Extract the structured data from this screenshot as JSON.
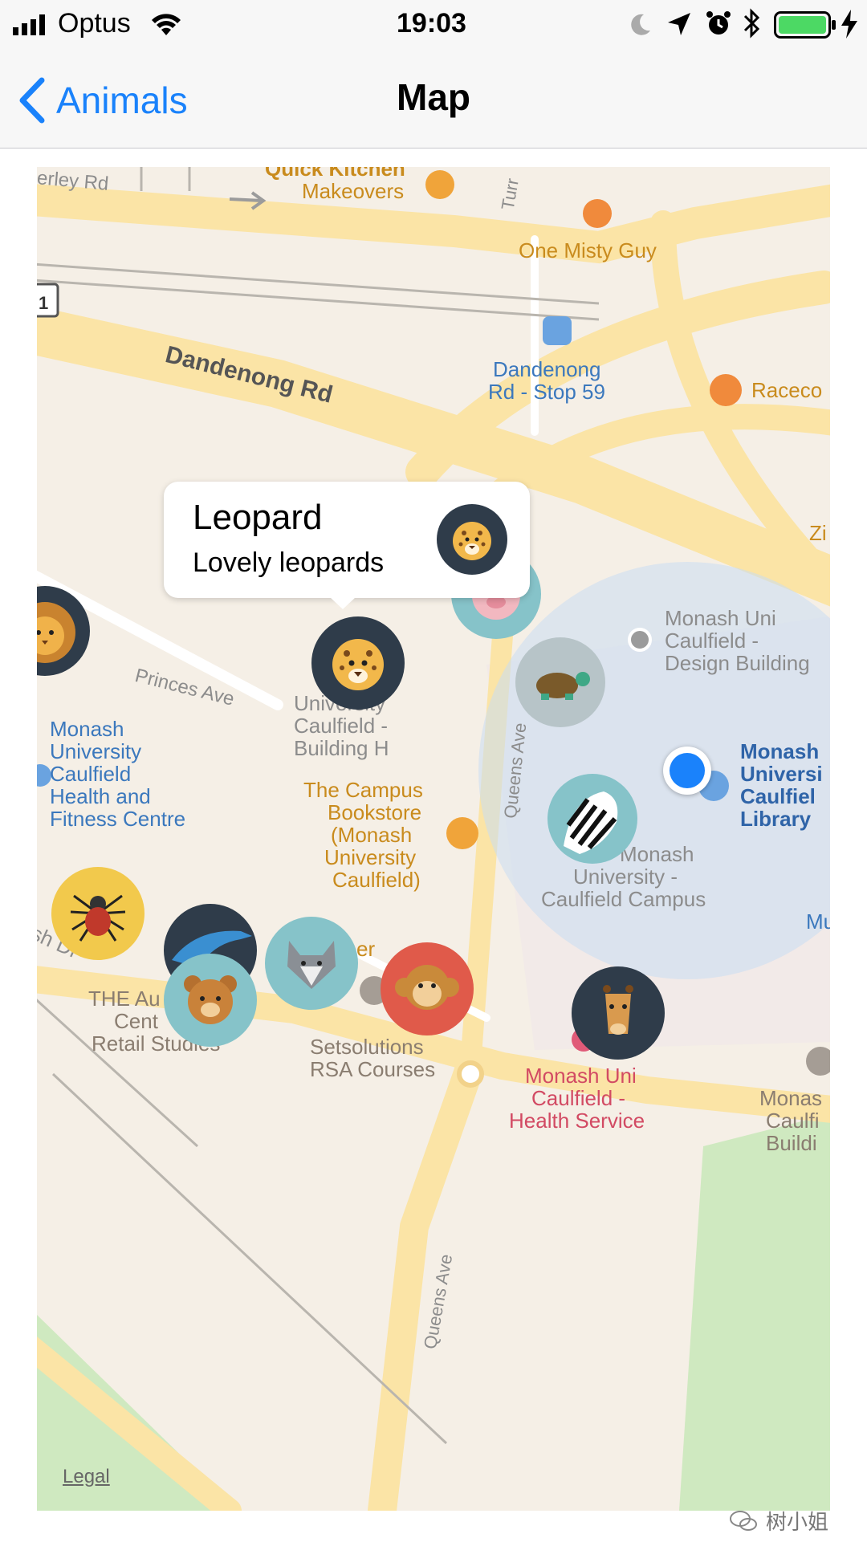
{
  "status_bar": {
    "carrier": "Optus",
    "time": "19:03"
  },
  "nav": {
    "back_label": "Animals",
    "title": "Map"
  },
  "callout": {
    "title": "Leopard",
    "subtitle": "Lovely leopards"
  },
  "map_labels": {
    "road_erley": "erley Rd",
    "quick_kitchen": "Quick Kitchen",
    "makeovers": "Makeovers",
    "one_misty_guy": "One Misty Guy",
    "dandenong_rd": "Dandenong Rd",
    "stop59_line1": "Dandenong",
    "stop59_line2": "Rd - Stop 59",
    "raceco": "Raceco",
    "zi": "Zi",
    "design_bldg_1": "Monash Uni",
    "design_bldg_2": "Caulfield -",
    "design_bldg_3": "Design Building",
    "princes_ave": "Princes Ave",
    "bldg_h_1": "University",
    "bldg_h_2": "Caulfield -",
    "bldg_h_3": "Building H",
    "health_fitness_1": "Monash",
    "health_fitness_2": "University",
    "health_fitness_3": "Caulfield",
    "health_fitness_4": "Health and",
    "health_fitness_5": "Fitness Centre",
    "queens_ave": "Queens Ave",
    "library_1": "Monash",
    "library_2": "Universi",
    "library_3": "Caulfiel",
    "library_4": "Library",
    "bookstore_1": "The Campus",
    "bookstore_2": "Bookstore",
    "bookstore_3": "(Monash",
    "bookstore_4": "University",
    "bookstore_5": "Caulfield)",
    "campus_1": "Monash",
    "campus_2": "University -",
    "campus_3": "Caulfield Campus",
    "mu": "Mu",
    "sh_dr": "sh Dr",
    "er": "er",
    "au_1": "THE Au",
    "au_2": "Cent",
    "au_3": "Retail Studies",
    "setsolutions_1": "Setsolutions",
    "setsolutions_2": "RSA Courses",
    "health_service_1": "Monash Uni",
    "health_service_2": "Caulfield -",
    "health_service_3": "Health Service",
    "right_bldg_1": "Monas",
    "right_bldg_2": "Caulfi",
    "right_bldg_3": "Buildi",
    "queens_ave_lower": "Queens Ave",
    "route_shield": "1",
    "turr": "Turr"
  },
  "legal": "Legal",
  "watermark": "树小姐",
  "colors": {
    "tint": "#1a82fb",
    "map_bg": "#f5efe6",
    "road": "#fbe5a8",
    "park": "#cfe9c0",
    "user_location": "#1a82fb"
  },
  "pins": [
    "lion-pin",
    "leopard-pin",
    "pig-pin",
    "turtle-pin",
    "zebra-pin",
    "spider-pin",
    "dolphin-pin",
    "wolf-pin",
    "bear-pin",
    "monkey-pin",
    "giraffe-pin"
  ]
}
